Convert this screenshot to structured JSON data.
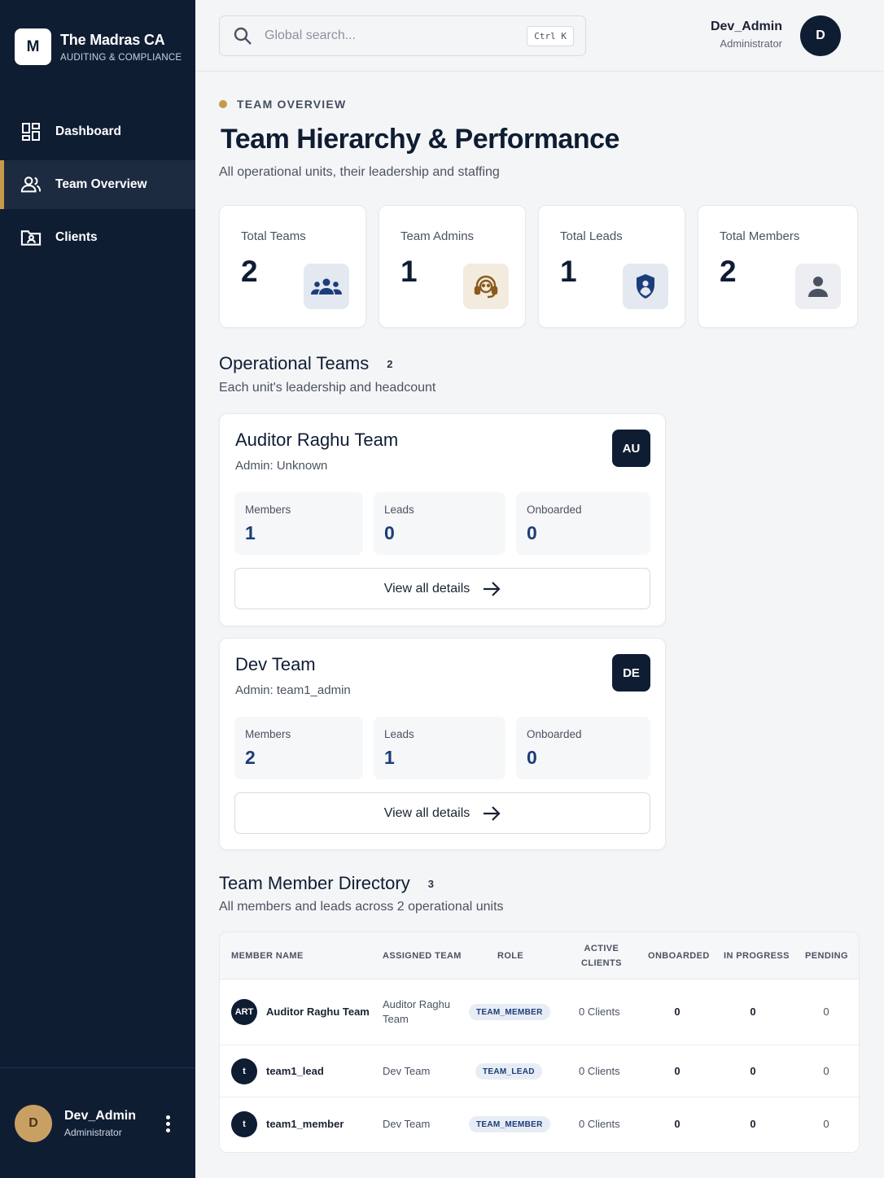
{
  "brand": {
    "logo_letter": "M",
    "title": "The Madras CA",
    "subtitle": "AUDITING & COMPLIANCE"
  },
  "nav": {
    "items": [
      {
        "label": "Dashboard",
        "icon": "dashboard-grid-icon",
        "active": false
      },
      {
        "label": "Team Overview",
        "icon": "team-users-icon",
        "active": true
      },
      {
        "label": "Clients",
        "icon": "client-folder-icon",
        "active": false
      }
    ]
  },
  "sidebar_user": {
    "initial": "D",
    "name": "Dev_Admin",
    "role": "Administrator"
  },
  "topbar": {
    "search_placeholder": "Global search...",
    "shortcut": "Ctrl K",
    "user_name": "Dev_Admin",
    "user_role": "Administrator",
    "user_initial": "D"
  },
  "page": {
    "eyebrow": "TEAM OVERVIEW",
    "title": "Team Hierarchy & Performance",
    "subtitle": "All operational units, their leadership and staffing"
  },
  "stats": [
    {
      "label": "Total Teams",
      "value": "2",
      "icon": "group-icon",
      "tint": "#e3e8f1",
      "icon_color": "#1c3d7a"
    },
    {
      "label": "Team Admins",
      "value": "1",
      "icon": "support-agent-icon",
      "tint": "#f3ebdd",
      "icon_color": "#8a5a1c"
    },
    {
      "label": "Total Leads",
      "value": "1",
      "icon": "shield-user-icon",
      "tint": "#e3e8f1",
      "icon_color": "#1c3d7a"
    },
    {
      "label": "Total Members",
      "value": "2",
      "icon": "person-icon",
      "tint": "#eceef1",
      "icon_color": "#4a5262"
    }
  ],
  "operational_teams": {
    "title": "Operational Teams",
    "count": "2",
    "subtitle": "Each unit's leadership and headcount",
    "metric_labels": {
      "members": "Members",
      "leads": "Leads",
      "onboarded": "Onboarded"
    },
    "view_label": "View all details",
    "teams": [
      {
        "name": "Auditor Raghu Team",
        "admin": "Admin: Unknown",
        "badge": "AU",
        "members": "1",
        "leads": "0",
        "onboarded": "0"
      },
      {
        "name": "Dev Team",
        "admin": "Admin: team1_admin",
        "badge": "DE",
        "members": "2",
        "leads": "1",
        "onboarded": "0"
      }
    ]
  },
  "directory": {
    "title": "Team Member Directory",
    "count": "3",
    "subtitle": "All members and leads across 2 operational units",
    "columns": {
      "member_name": "MEMBER NAME",
      "assigned_team": "ASSIGNED TEAM",
      "role": "ROLE",
      "active_clients_1": "ACTIVE",
      "active_clients_2": "CLIENTS",
      "onboarded": "ONBOARDED",
      "in_progress": "IN PROGRESS",
      "pending": "PENDING"
    },
    "rows": [
      {
        "avatar": "ART",
        "name": "Auditor Raghu Team",
        "team_line1": "Auditor Raghu",
        "team_line2": "Team",
        "role": "TEAM_MEMBER",
        "active_clients": "0 Clients",
        "onboarded": "0",
        "in_progress": "0",
        "pending": "0"
      },
      {
        "avatar": "t",
        "name": "team1_lead",
        "team_line1": "Dev Team",
        "team_line2": "",
        "role": "TEAM_LEAD",
        "active_clients": "0 Clients",
        "onboarded": "0",
        "in_progress": "0",
        "pending": "0"
      },
      {
        "avatar": "t",
        "name": "team1_member",
        "team_line1": "Dev Team",
        "team_line2": "",
        "role": "TEAM_MEMBER",
        "active_clients": "0 Clients",
        "onboarded": "0",
        "in_progress": "0",
        "pending": "0"
      }
    ]
  }
}
